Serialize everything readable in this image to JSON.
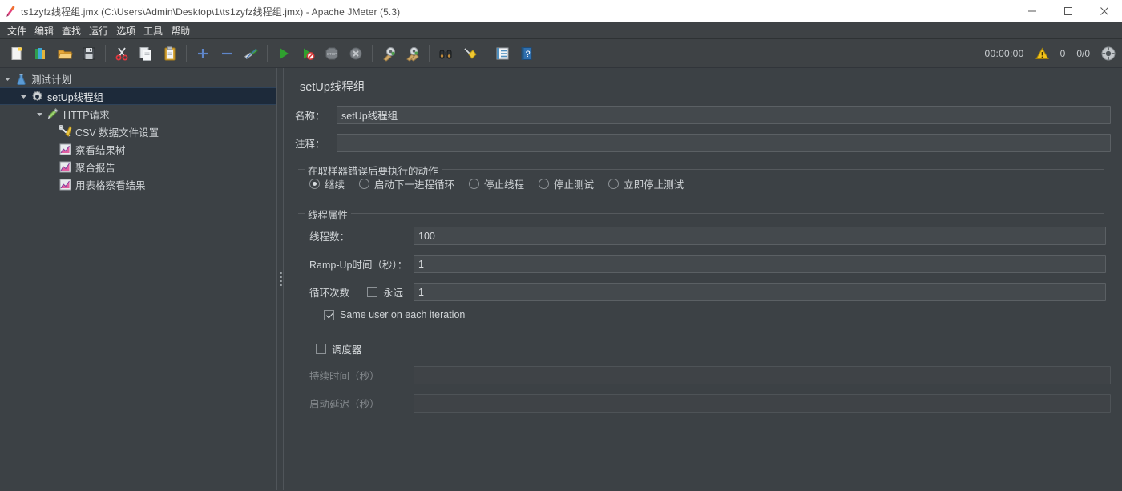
{
  "window": {
    "title": "ts1zyfz线程组.jmx (C:\\Users\\Admin\\Desktop\\1\\ts1zyfz线程组.jmx) - Apache JMeter (5.3)",
    "minimize": "—",
    "maximize": "□",
    "close": "✕"
  },
  "menubar": {
    "items": [
      {
        "label": "文件"
      },
      {
        "label": "编辑"
      },
      {
        "label": "查找"
      },
      {
        "label": "运行"
      },
      {
        "label": "选项"
      },
      {
        "label": "工具"
      },
      {
        "label": "帮助"
      }
    ]
  },
  "toolbar": {
    "buttons": [
      {
        "icon": "new-file-icon"
      },
      {
        "icon": "templates-icon"
      },
      {
        "icon": "open-folder-icon"
      },
      {
        "icon": "save-icon"
      },
      {
        "sep": true
      },
      {
        "icon": "cut-scissors-icon"
      },
      {
        "icon": "copy-icon"
      },
      {
        "icon": "paste-clipboard-icon"
      },
      {
        "sep": true
      },
      {
        "icon": "expand-plus-icon"
      },
      {
        "icon": "collapse-minus-icon"
      },
      {
        "icon": "toggle-enable-icon"
      },
      {
        "sep": true
      },
      {
        "icon": "start-play-icon"
      },
      {
        "icon": "start-no-timers-icon"
      },
      {
        "icon": "stop-icon"
      },
      {
        "icon": "shutdown-icon"
      },
      {
        "sep": true
      },
      {
        "icon": "clear-icon"
      },
      {
        "icon": "clear-all-icon"
      },
      {
        "sep": true
      },
      {
        "icon": "search-binoculars-icon"
      },
      {
        "icon": "search-reset-broom-icon"
      },
      {
        "sep": true
      },
      {
        "icon": "function-helper-icon"
      },
      {
        "icon": "help-icon"
      }
    ],
    "timer": "00:00:00",
    "warning_count": "0",
    "thread_count": "0/0",
    "error_icon": "warning-triangle-icon",
    "threads_icon": "active-threads-icon"
  },
  "sidebar": {
    "tree": [
      {
        "label": "测试计划",
        "depth": 0,
        "icon": "test-plan-icon",
        "toggle": "down",
        "selected": false
      },
      {
        "label": "setUp线程组",
        "depth": 1,
        "icon": "thread-group-icon",
        "toggle": "down",
        "selected": true
      },
      {
        "label": "HTTP请求",
        "depth": 2,
        "icon": "http-request-icon",
        "toggle": "down",
        "selected": false
      },
      {
        "label": "CSV 数据文件设置",
        "depth": 3,
        "icon": "csv-config-icon",
        "toggle": "",
        "selected": false
      },
      {
        "label": "察看结果树",
        "depth": 3,
        "icon": "listener-icon",
        "toggle": "",
        "selected": false
      },
      {
        "label": "聚合报告",
        "depth": 3,
        "icon": "listener-icon",
        "toggle": "",
        "selected": false
      },
      {
        "label": "用表格察看结果",
        "depth": 3,
        "icon": "listener-icon",
        "toggle": "",
        "selected": false
      }
    ]
  },
  "main": {
    "panel_title": "setUp线程组",
    "name_label": "名称：",
    "name_value": "setUp线程组",
    "comment_label": "注释：",
    "comment_value": "",
    "comment_placeholder": "",
    "error_action": {
      "group_title": "在取样器错误后要执行的动作",
      "options": [
        {
          "label": "继续",
          "checked": true
        },
        {
          "label": "启动下一进程循环",
          "checked": false
        },
        {
          "label": "停止线程",
          "checked": false
        },
        {
          "label": "停止测试",
          "checked": false
        },
        {
          "label": "立即停止测试",
          "checked": false
        }
      ]
    },
    "thread_props": {
      "group_title": "线程属性",
      "num_threads_label": "线程数：",
      "num_threads_value": "100",
      "ramp_up_label": "Ramp-Up时间（秒）：",
      "ramp_up_value": "1",
      "loop_count_label": "循环次数",
      "forever_label": "永远",
      "forever_checked": false,
      "loop_count_value": "1",
      "same_user_label": "Same user on each iteration",
      "same_user_checked": true
    },
    "scheduler": {
      "scheduler_label": "调度器",
      "scheduler_checked": false,
      "duration_label": "持续时间（秒）",
      "duration_value": "",
      "startup_delay_label": "启动延迟（秒）",
      "startup_delay_value": ""
    }
  },
  "colors": {
    "background": "#3c4145",
    "titlebar": "#ffffff",
    "selection": "#1d2a3a",
    "field": "#44494d",
    "text": "#d0d4d7"
  }
}
